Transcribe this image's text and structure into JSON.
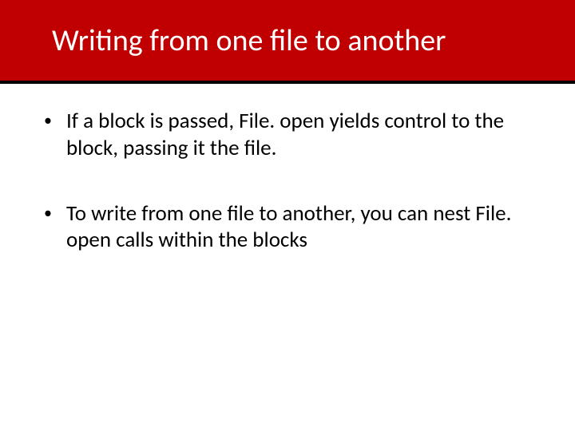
{
  "title": "Writing from one file to another",
  "bullets": [
    {
      "marker": "•",
      "text": "If a block is passed, File. open yields control to the block, passing it the file."
    },
    {
      "marker": "•",
      "text": "To write from one file to another, you can nest File. open calls within the blocks"
    }
  ]
}
